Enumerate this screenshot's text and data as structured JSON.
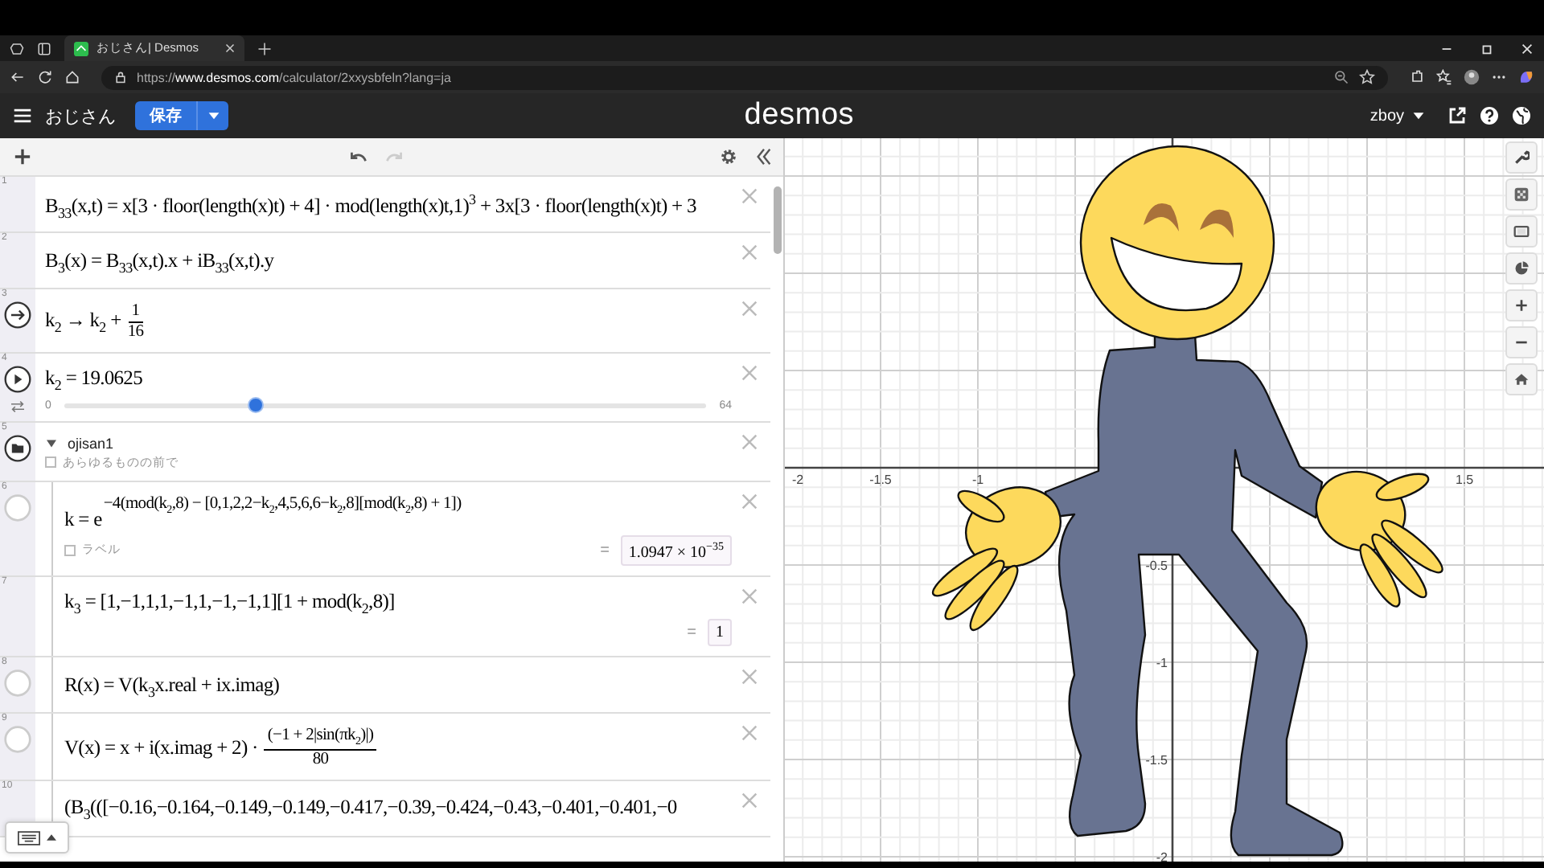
{
  "browser": {
    "tab_title": "おじさん| Desmos",
    "url": "https://**www.desmos.com**/calculator/2xxysbfeln?lang=ja"
  },
  "header": {
    "title": "おじさん",
    "save_label": "保存",
    "logo": "desmos",
    "user": "zboy"
  },
  "toolbar": {
    "undo_disabled": false,
    "redo_disabled": true
  },
  "expressions": [
    {
      "number": "1",
      "kind": "none",
      "math": "B$_{33}$(x,t) = x[3 · floor(length(x)t) + 4] · mod(length(x)t,1)$^{3}$ + 3x[3 · floor(length(x)t) + 3"
    },
    {
      "number": "2",
      "kind": "none",
      "math": "B$_{3}$(x) = B$_{33}$(x,t).x + iB$_{33}$(x,t).y"
    },
    {
      "number": "3",
      "kind": "action",
      "math": "k$_{2}$ → k$_{2}$ +",
      "fraction": {
        "numerator": "1",
        "denominator": "16"
      }
    },
    {
      "number": "4",
      "kind": "play",
      "math": "k$_{2}$ = 19.0625",
      "slider": {
        "min": "0",
        "max": "64",
        "level": 0.298
      }
    },
    {
      "number": "5",
      "kind": "folder",
      "title": "ojisan1",
      "expanded": true,
      "option": {
        "label": "あらゆるものの前で",
        "checked": false
      },
      "children": [
        {
          "number": "6",
          "kind": "hidden",
          "math": "k = e",
          "exponent": "−4(mod(k$_{2}$,8) − [0,1,2,2−k$_{2}$,4,5,6,6−k$_{2}$,8][mod(k$_{2}$,8) + 1])",
          "option": {
            "label": "ラベル",
            "checked": false
          },
          "result": {
            "sign": "=",
            "value": "1.0947 × 10$^{−35}$"
          }
        },
        {
          "number": "7",
          "kind": "none",
          "math": "k$_{3}$ = [1,−1,1,1,−1,1,−1,−1,1][1 + mod(k$_{2}$,8)]",
          "result": {
            "sign": "=",
            "value": "1"
          }
        },
        {
          "number": "8",
          "kind": "hidden",
          "math": "R(x) = V(k$_{3}$x.real + ix.imag)"
        },
        {
          "number": "9",
          "kind": "hidden",
          "math": "V(x) = x + i(x.imag + 2) ·",
          "fraction": {
            "numerator": "(−1 + 2|sin(πk$_{2}$)|)",
            "denominator": "80"
          }
        },
        {
          "number": "10",
          "kind": "none",
          "math": "(B$_{3}$(([−0.16,−0.164,−0.149,−0.149,−0.417,−0.39,−0.424,−0.43,−0.401,−0.401,−0"
        }
      ]
    }
  ],
  "graph": {
    "x_ticks": [
      "-2",
      "-1.5",
      "-1",
      "1.5"
    ],
    "y_ticks": [
      "-0.5",
      "-1",
      "-1.5",
      "-2"
    ]
  }
}
